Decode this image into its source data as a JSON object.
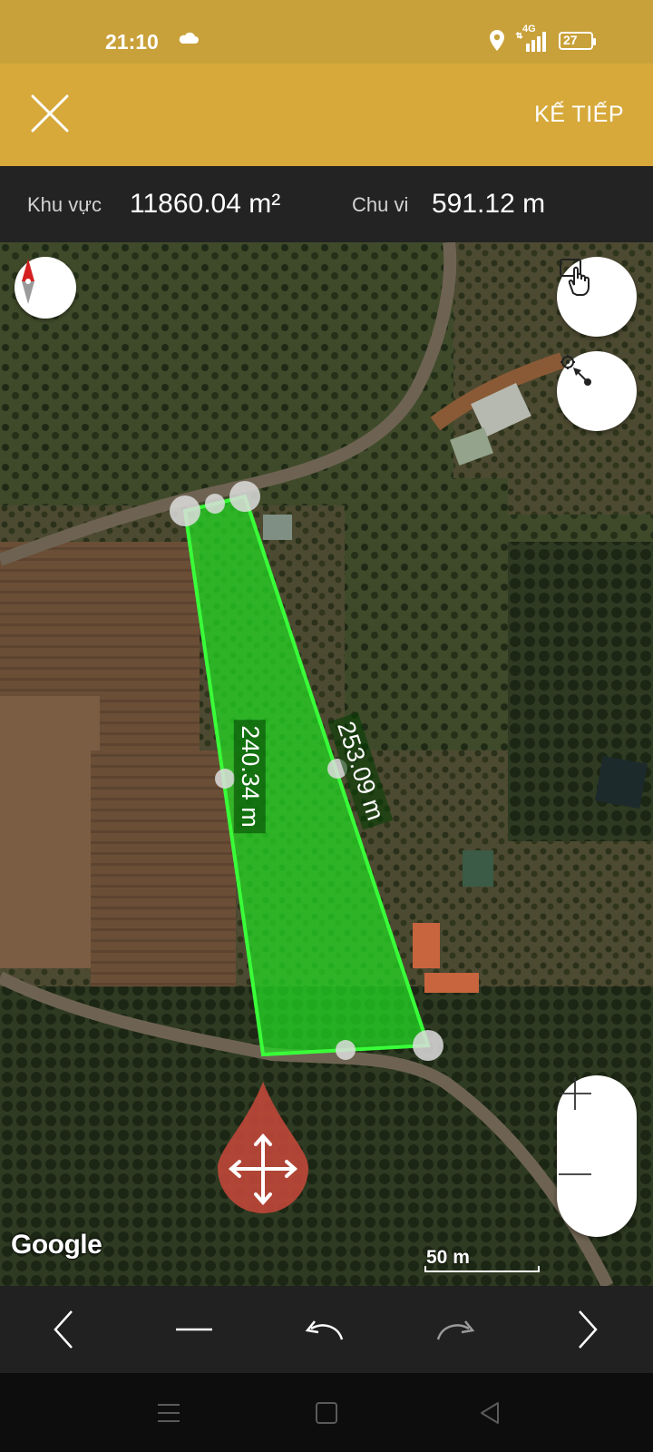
{
  "status_bar": {
    "time": "21:10",
    "network": "4G",
    "battery": "27",
    "icons": [
      "cloud-icon",
      "location-icon",
      "signal-icon",
      "battery-icon"
    ]
  },
  "header": {
    "close_icon": "close-icon",
    "next_label": "KẾ TIẾP"
  },
  "measurements": {
    "area_label": "Khu vực",
    "area_value": "11860.04 m²",
    "perimeter_label": "Chu vi",
    "perimeter_value": "591.12 m"
  },
  "map": {
    "edge_labels": [
      "240.34 m",
      "253.09 m"
    ],
    "attribution": "Google",
    "scale_label": "50 m",
    "polygon_color": "#22dd22",
    "move_marker_color": "#c0483a",
    "buttons": [
      "compass-icon",
      "touch-mode-icon",
      "point-mode-icon",
      "zoom-in-icon",
      "zoom-out-icon",
      "move-icon"
    ]
  },
  "toolbar": {
    "icons": [
      "previous-icon",
      "delete-icon",
      "undo-icon",
      "redo-icon",
      "next-icon"
    ]
  },
  "nav_bar": {
    "icons": [
      "menu-icon",
      "home-icon",
      "back-icon"
    ]
  },
  "colors": {
    "header": "#d7a93a",
    "status_bar": "#c9a13a",
    "measure_bar": "#232323"
  }
}
